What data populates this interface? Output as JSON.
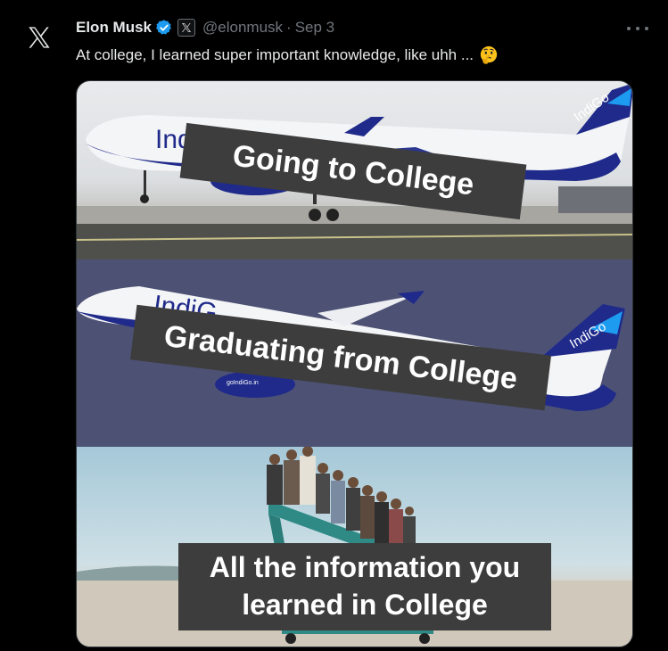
{
  "author": {
    "name": "Elon Musk",
    "handle": "@elonmusk",
    "separator": "·",
    "date": "Sep 3",
    "affiliate_badge": "X"
  },
  "tweet": {
    "text": "At college, I learned super important knowledge, like uhh ...",
    "emoji": "thinking-face-emoji"
  },
  "meme": {
    "panel1_caption": "Going to College",
    "panel2_caption": "Graduating from College",
    "panel3_caption_line1": "All the information you",
    "panel3_caption_line2": "learned in College",
    "plane_brand": "IndiGo",
    "plane_url": "goIndiGo.in",
    "plane_partial_text": "Ind",
    "plane_partial_text_2": "IndiG"
  },
  "colors": {
    "background": "#000000",
    "text_primary": "#e7e9ea",
    "text_secondary": "#71767b",
    "verified_blue": "#1d9bf0",
    "indigo_blue": "#1f2a8a",
    "caption_bg": "#3d3d3d"
  },
  "icons": {
    "logo": "x-logo-icon",
    "verified": "verified-badge-icon",
    "more": "more-options-icon"
  }
}
